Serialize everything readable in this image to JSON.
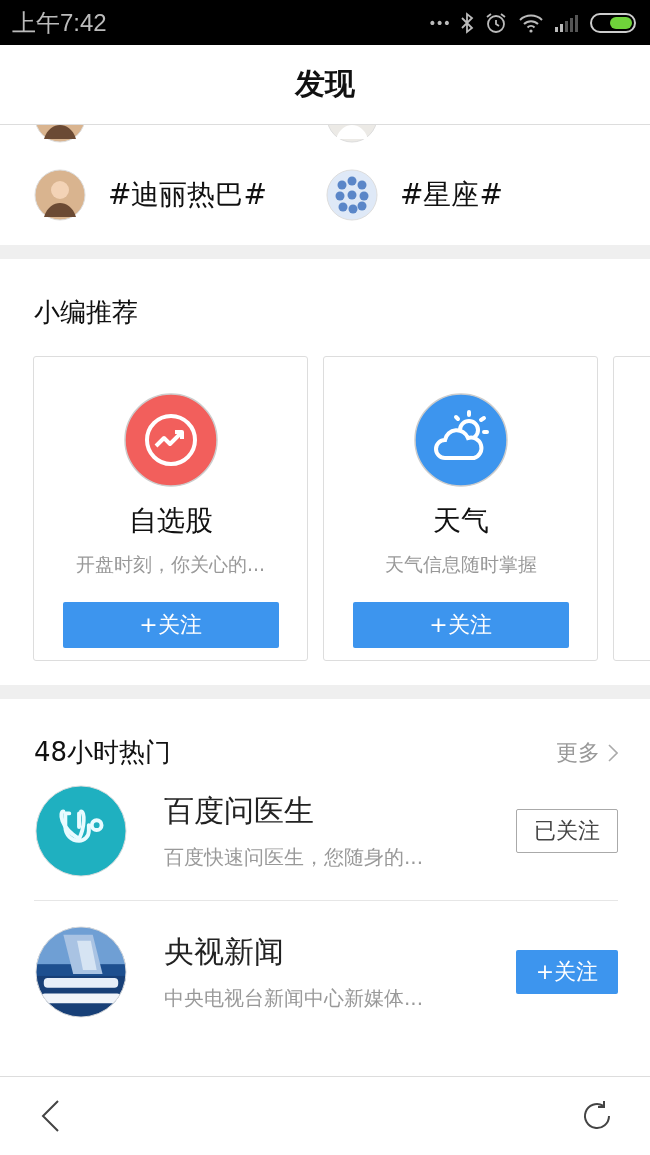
{
  "status_bar": {
    "time": "上午7:42",
    "dots": "•••"
  },
  "header": {
    "title": "发现"
  },
  "topics": [
    {
      "kind": "person"
    },
    {
      "kind": "person-light"
    },
    {
      "label": "#迪丽热巴#",
      "kind": "person"
    },
    {
      "label": "#星座#",
      "kind": "zodiac"
    }
  ],
  "recommended": {
    "title": "小编推荐",
    "cards": [
      {
        "name": "自选股",
        "description": "开盘时刻，你关心的...",
        "kind": "chart",
        "color": "#f25f5c",
        "button": "+关注"
      },
      {
        "name": "天气",
        "description": "天气信息随时掌握",
        "kind": "weather",
        "color": "#3d95ee",
        "button": "+关注"
      }
    ]
  },
  "hot": {
    "title": "48小时热门",
    "more": "更多",
    "items": [
      {
        "name": "百度问医生",
        "description": "百度快速问医生，您随身的...",
        "kind": "stethoscope",
        "button": "已关注",
        "followed": true
      },
      {
        "name": "央视新闻",
        "description": "中央电视台新闻中心新媒体...",
        "kind": "picture",
        "button": "+关注",
        "followed": false
      }
    ]
  }
}
